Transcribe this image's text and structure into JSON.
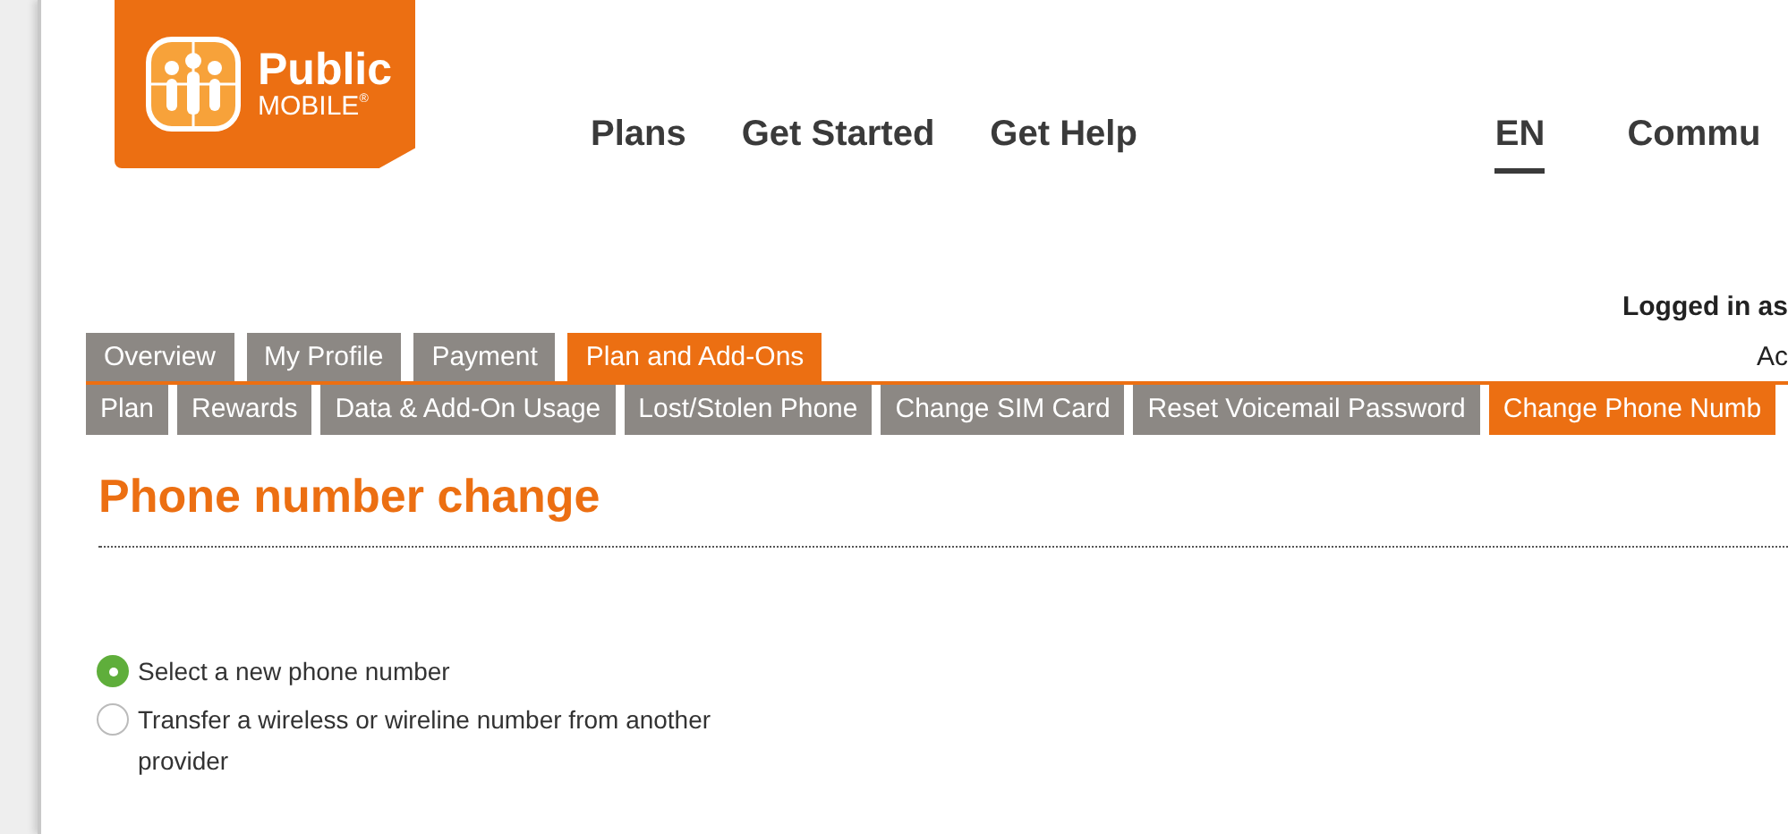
{
  "logo": {
    "line_1": "Public",
    "line_2": "MOBILE",
    "mark": "®"
  },
  "nav": [
    {
      "label": "Plans",
      "selected": false
    },
    {
      "label": "Get Started",
      "selected": false
    },
    {
      "label": "Get Help",
      "selected": false
    }
  ],
  "language": {
    "label": "EN",
    "selected": true
  },
  "nav_cut": "Commu",
  "account": {
    "logged_in": "Logged in as",
    "line_2": "Ac"
  },
  "tabs": [
    {
      "label": "Overview",
      "selected": false
    },
    {
      "label": "My Profile",
      "selected": false
    },
    {
      "label": "Payment",
      "selected": false
    },
    {
      "label": "Plan and Add-Ons",
      "selected": true
    }
  ],
  "subtabs": [
    {
      "label": "Plan",
      "selected": false
    },
    {
      "label": "Rewards",
      "selected": false
    },
    {
      "label": "Data & Add-On Usage",
      "selected": false
    },
    {
      "label": "Lost/Stolen Phone",
      "selected": false
    },
    {
      "label": "Change SIM Card",
      "selected": false
    },
    {
      "label": "Reset Voicemail Password",
      "selected": false
    },
    {
      "label": "Change Phone Numb",
      "selected": true
    }
  ],
  "heading": "Phone number change",
  "options": [
    {
      "label": "Select a new phone number",
      "selected": true
    },
    {
      "label": "Transfer a wireless or wireline number from another provider",
      "selected": false
    }
  ]
}
